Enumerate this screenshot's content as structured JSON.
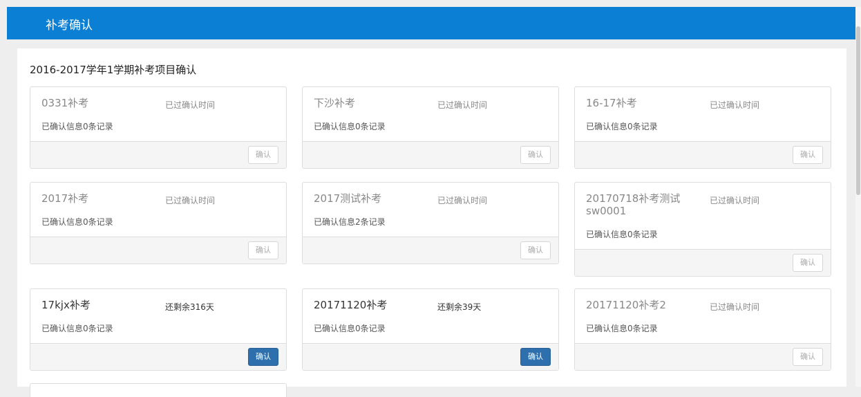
{
  "header": {
    "title": "补考确认"
  },
  "section": {
    "title": "2016-2017学年1学期补考项目确认"
  },
  "cards": [
    {
      "name": "0331补考",
      "status": "已过确认时间",
      "info": "已确认信息0条记录",
      "button": "确认",
      "button_enabled": false
    },
    {
      "name": "下沙补考",
      "status": "已过确认时间",
      "info": "已确认信息0条记录",
      "button": "确认",
      "button_enabled": false
    },
    {
      "name": "16-17补考",
      "status": "已过确认时间",
      "info": "已确认信息0条记录",
      "button": "确认",
      "button_enabled": false
    },
    {
      "name": "2017补考",
      "status": "已过确认时间",
      "info": "已确认信息0条记录",
      "button": "确认",
      "button_enabled": false
    },
    {
      "name": "2017测试补考",
      "status": "已过确认时间",
      "info": "已确认信息2条记录",
      "button": "确认",
      "button_enabled": false
    },
    {
      "name": "20170718补考测试sw0001",
      "status": "已过确认时间",
      "info": "已确认信息0条记录",
      "button": "确认",
      "button_enabled": false
    },
    {
      "name": "17kjx补考",
      "status": "还剩余316天",
      "info": "已确认信息0条记录",
      "button": "确认",
      "button_enabled": true
    },
    {
      "name": "20171120补考",
      "status": "还剩余39天",
      "info": "已确认信息0条记录",
      "button": "确认",
      "button_enabled": true
    },
    {
      "name": "20171120补考2",
      "status": "已过确认时间",
      "info": "已确认信息0条记录",
      "button": "确认",
      "button_enabled": false
    }
  ],
  "colors": {
    "header": "#0b7fd3",
    "primary_button": "#2e6fad",
    "disabled_text": "#aaaaaa"
  }
}
